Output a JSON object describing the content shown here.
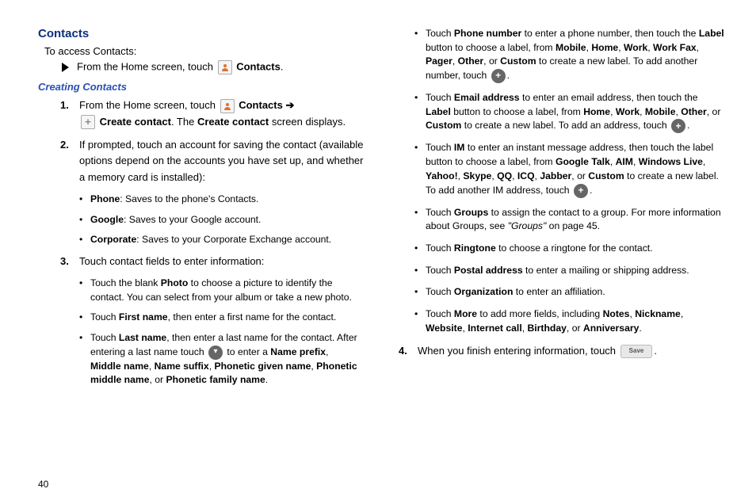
{
  "pageNumber": "40",
  "headings": {
    "contacts": "Contacts",
    "creating": "Creating Contacts"
  },
  "intro": "To access Contacts:",
  "fromHome": "From the Home screen, touch",
  "contactsLabel": "Contacts",
  "step1": {
    "num": "1.",
    "prefix": "From the Home screen, touch",
    "contacts": "Contacts",
    "arrow": "➔",
    "create": "Create contact",
    "tail": ". The",
    "screen": "Create contact",
    "tail2": " screen displays."
  },
  "step2": {
    "num": "2.",
    "text": "If prompted, touch an account for saving the contact (available options depend on the accounts you have set up, and whether a memory card is installed):"
  },
  "step2items": [
    {
      "b": "Phone",
      "t": ": Saves to the phone's Contacts."
    },
    {
      "b": "Google",
      "t": ": Saves to your Google account."
    },
    {
      "b": "Corporate",
      "t": ": Saves to your Corporate Exchange account."
    }
  ],
  "step3": {
    "num": "3.",
    "text": "Touch contact fields to enter information:"
  },
  "step3items": {
    "photo": {
      "pre": "Touch the blank ",
      "b": "Photo",
      "post": " to choose a picture to identify the contact. You can select from your album or take a new photo."
    },
    "first": {
      "pre": "Touch ",
      "b": "First name",
      "post": ", then enter a first name for the contact."
    },
    "last": {
      "pre": "Touch ",
      "b1": "Last name",
      "mid": ", then enter a last name for the contact. After entering a last name touch ",
      "mid2": " to enter a ",
      "b2": "Name prefix",
      "c": ", ",
      "b3": "Middle name",
      "b4": "Name suffix",
      "b5": "Phonetic given name",
      "b6": "Phonetic middle name",
      "or": ", or ",
      "b7": "Phonetic family name",
      "end": "."
    }
  },
  "col2": {
    "phone": {
      "pre": "Touch ",
      "b1": "Phone number",
      "mid": " to enter a phone number, then touch the ",
      "b2": "Label",
      "mid2": " button to choose a label, from ",
      "opts": [
        "Mobile",
        "Home",
        "Work",
        "Work Fax",
        "Pager",
        "Other"
      ],
      "or": ", or ",
      "bc": "Custom",
      "tail": "  to create a new label. To add another number, touch ",
      "end": "."
    },
    "email": {
      "pre": "Touch ",
      "b1": "Email address",
      "mid": " to enter an email address, then touch the ",
      "b2": "Label",
      "mid2": " button to choose a label, from ",
      "opts": [
        "Home",
        "Work",
        "Mobile",
        "Other"
      ],
      "or": ", or ",
      "bc": "Custom",
      "tail": "  to create a new label. To add an address, touch ",
      "end": "."
    },
    "im": {
      "pre": "Touch ",
      "b1": "IM",
      "mid": " to enter an instant message address, then touch the label button to choose a label, from ",
      "opts": [
        "Google Talk",
        "AIM",
        "Windows Live",
        "Yahoo!",
        "Skype",
        "QQ",
        "ICQ",
        "Jabber"
      ],
      "or": ", or ",
      "bc": "Custom",
      "tail": " to create a new label. To add another IM address, touch ",
      "end": "."
    },
    "groups": {
      "pre": "Touch ",
      "b": "Groups",
      "mid": " to assign the contact to a group. For more information about Groups, see ",
      "ref": "\"Groups\"",
      "tail": " on page 45."
    },
    "ringtone": {
      "pre": "Touch ",
      "b": "Ringtone",
      "post": " to choose a ringtone for the contact."
    },
    "postal": {
      "pre": "Touch ",
      "b": "Postal address",
      "post": " to enter a mailing or shipping address."
    },
    "org": {
      "pre": "Touch ",
      "b": "Organization",
      "post": " to enter an affiliation."
    },
    "more": {
      "pre": "Touch ",
      "b": "More",
      "mid": " to add more fields, including ",
      "opts": [
        "Notes",
        "Nickname",
        "Website",
        "Internet call",
        "Birthday"
      ],
      "or": ", or ",
      "last": "Anniversary",
      "end": "."
    }
  },
  "step4": {
    "num": "4.",
    "text": "When you finish entering information, touch",
    "save": "Save",
    "end": "."
  }
}
